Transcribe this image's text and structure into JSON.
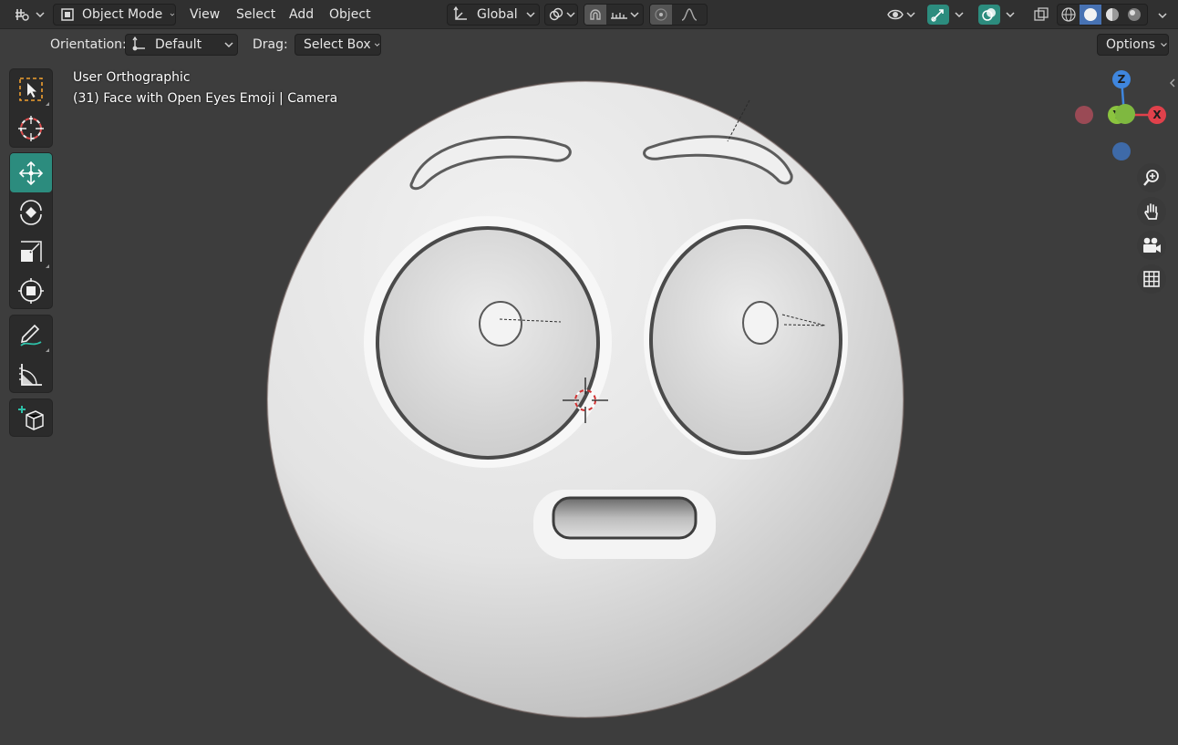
{
  "header": {
    "editor_type_icon": "editor-type-icon",
    "mode": "Object Mode",
    "menus": [
      "View",
      "Select",
      "Add",
      "Object"
    ],
    "transform_orientation": "Global",
    "options_label": "Options"
  },
  "tool_header": {
    "orientation_label": "Orientation:",
    "orientation_value": "Default",
    "drag_label": "Drag:",
    "drag_value": "Select Box"
  },
  "viewport": {
    "view_name": "User Orthographic",
    "object_info": "(31) Face with Open Eyes Emoji | Camera"
  },
  "toolbar": {
    "tools": [
      "select-box-tool",
      "cursor-tool",
      "move-tool",
      "rotate-tool",
      "scale-tool",
      "transform-tool",
      "annotate-tool",
      "measure-tool",
      "add-cube-tool"
    ],
    "active_tool": "move-tool"
  },
  "nav_gizmo": {
    "x_label": "X",
    "y_label": "Y",
    "z_label": "Z"
  },
  "colors": {
    "header_bg": "#303030",
    "viewport_bg": "#3d3d3d",
    "active_tool": "#2c8c7e",
    "axis_x": "#e0414b",
    "axis_y": "#8bc43f",
    "axis_z": "#3f86de",
    "selected_toggle": "#4772b3"
  }
}
